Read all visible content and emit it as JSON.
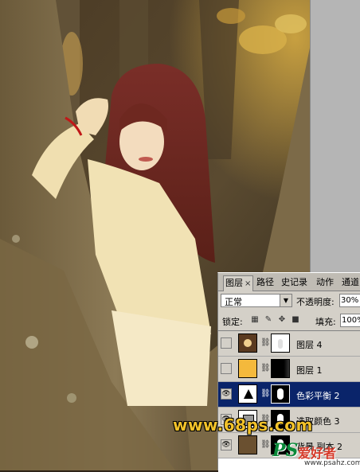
{
  "layers_panel": {
    "tabs": [
      {
        "label": "图层"
      },
      {
        "label": "路径"
      },
      {
        "label": "史记录"
      },
      {
        "label": "动作"
      },
      {
        "label": "通道"
      }
    ],
    "close_glyph": "×",
    "blend_mode": "正常",
    "opacity_label": "不透明度:",
    "opacity_value": "30%",
    "lock_label": "锁定:",
    "fill_label": "填充:",
    "fill_value": "100%",
    "layers": [
      {
        "name": "图层 4",
        "visible": false,
        "thumb": "photo-thumb",
        "mask": "white-mask"
      },
      {
        "name": "图层 1",
        "visible": false,
        "thumb": "orange-fill",
        "mask": "black-mask"
      },
      {
        "name": "色彩平衡 2",
        "visible": true,
        "thumb": "balance-adjustment-icon",
        "mask": "figure-mask",
        "selected": true
      },
      {
        "name": "选取颜色 3",
        "visible": true,
        "thumb": "selective-color-adjustment-icon",
        "mask": "figure-mask"
      },
      {
        "name": "背景 副本 2",
        "visible": true,
        "thumb": "photo-thumb",
        "mask": "figure-mask"
      }
    ]
  },
  "watermarks": {
    "site_68ps": "www.68ps.com",
    "ps_logo": "PS",
    "ps_cn": "爱好者",
    "ps_url": "www.psahz.com"
  },
  "colors": {
    "selection": "#0a246a",
    "panel_bg": "#d4d0c8",
    "watermark_yellow": "#f2c22a",
    "orange_fill": "#f4b93c"
  }
}
